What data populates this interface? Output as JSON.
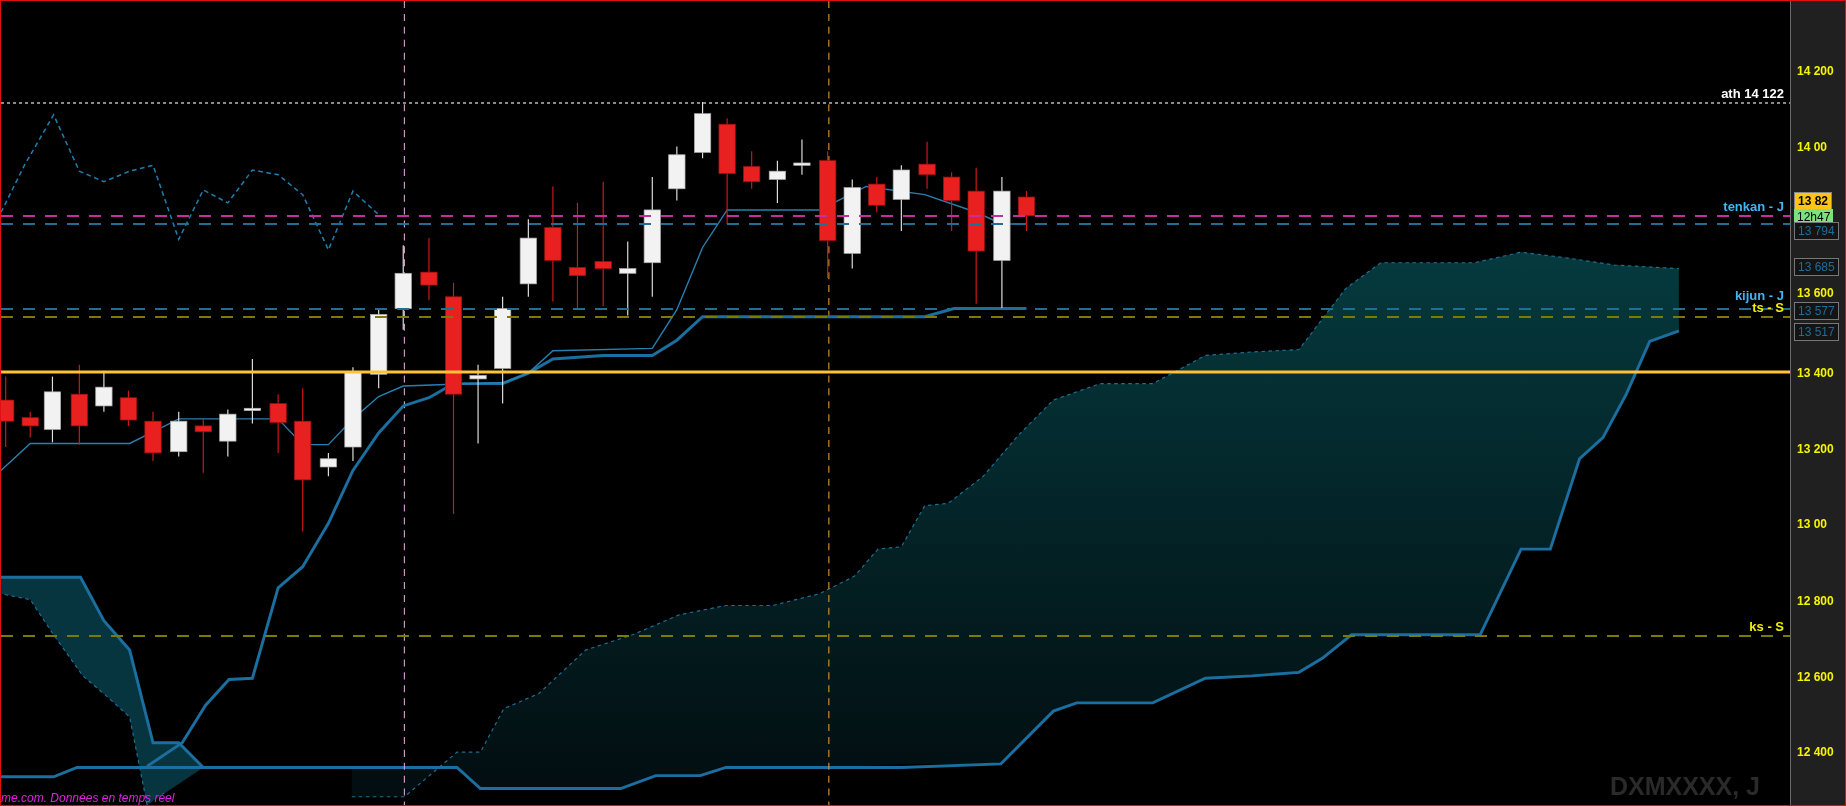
{
  "chart": {
    "source_note": "me.com. Données en temps réel",
    "symbol_label": "DXMXXXX, J"
  },
  "level_lines": [
    {
      "label": "ath 14 122",
      "color": "#8a8a8a"
    },
    {
      "label": "tenkan - J",
      "color": "#c42f9c"
    },
    {
      "color": "#1f6f95"
    },
    {
      "label": "kijun - J",
      "color": "#1f6f95"
    },
    {
      "label": "ts - S",
      "color": "#7d7a00"
    },
    {
      "color": "#ffc23a"
    },
    {
      "label": "ks - S",
      "color": "#7d7a00"
    }
  ],
  "price_axis": {
    "ticks": [
      "14 200",
      "14 00",
      "13 600",
      "13 400",
      "13 200",
      "13 00",
      "12 800",
      "12 600",
      "12 400"
    ],
    "badges": [
      {
        "kind": "price",
        "text": "13 82"
      },
      {
        "kind": "time",
        "text": "12h47"
      },
      {
        "kind": "indicator",
        "text": "13 794"
      },
      {
        "kind": "indicator",
        "text": "13 685"
      },
      {
        "kind": "indicator",
        "text": "13 577"
      },
      {
        "kind": "indicator",
        "text": "13 517"
      }
    ]
  }
}
